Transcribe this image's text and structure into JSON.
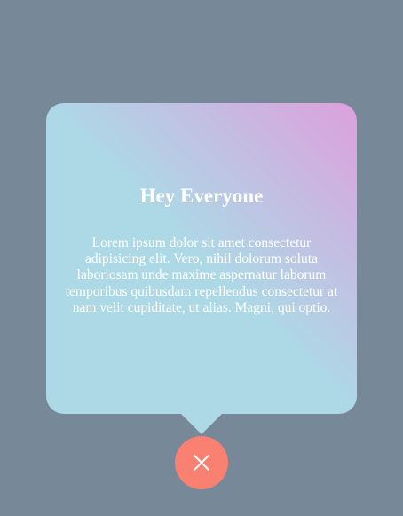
{
  "card": {
    "title": "Hey Everyone",
    "body": "Lorem ipsum dolor sit amet consectetur adipisicing elit. Vero, nihil dolorum soluta laboriosam unde maxime aspernatur laborum temporibus quibusdam repellendus consectetur at nam velit cupiditate, ut alias. Magni, qui optio."
  },
  "close_button": {
    "icon": "close-icon"
  },
  "colors": {
    "background": "#778899",
    "gradient_start": "#dda0dd",
    "gradient_end": "#add8e6",
    "close_button": "#fa8072",
    "text": "#ffffff"
  }
}
